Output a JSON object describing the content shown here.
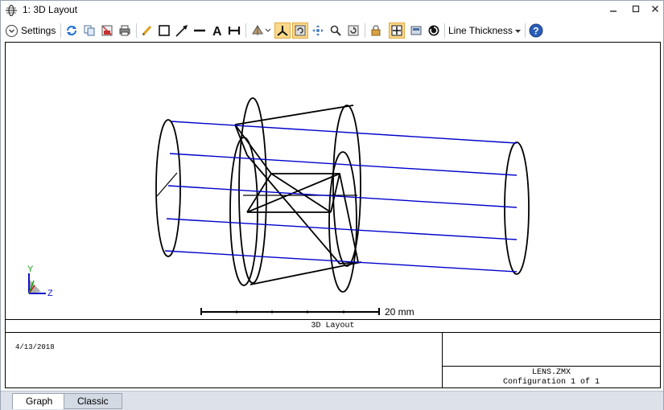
{
  "window": {
    "title": "1: 3D Layout",
    "minimize_icon": "minimize-icon",
    "maximize_icon": "maximize-icon",
    "close_icon": "close-icon"
  },
  "toolbar": {
    "settings_label": "Settings",
    "line_thickness_label": "Line Thickness",
    "icons": [
      "refresh-icon",
      "copy-icon",
      "save-icon",
      "print-icon",
      "pencil-icon",
      "rectangle-icon",
      "arrow-icon",
      "line-icon",
      "text-icon",
      "dimension-icon",
      "rotate-view-icon",
      "axes-icon",
      "auto-rotate-icon",
      "pan-icon",
      "zoom-icon",
      "reset-view-icon",
      "lock-icon",
      "fit-window-icon",
      "export-icon",
      "clock-icon",
      "help-icon"
    ]
  },
  "plot": {
    "scale_label": "20 mm",
    "axis_y_label": "Y",
    "axis_z_label": "Z",
    "footer_title": "3D Layout",
    "date": "4/13/2018",
    "file_name": "LENS.ZMX",
    "configuration": "Configuration 1 of 1",
    "ray_color": "#0000cc",
    "lens_color": "#000000"
  },
  "tabs": [
    {
      "label": "Graph",
      "active": true
    },
    {
      "label": "Classic",
      "active": false
    }
  ]
}
